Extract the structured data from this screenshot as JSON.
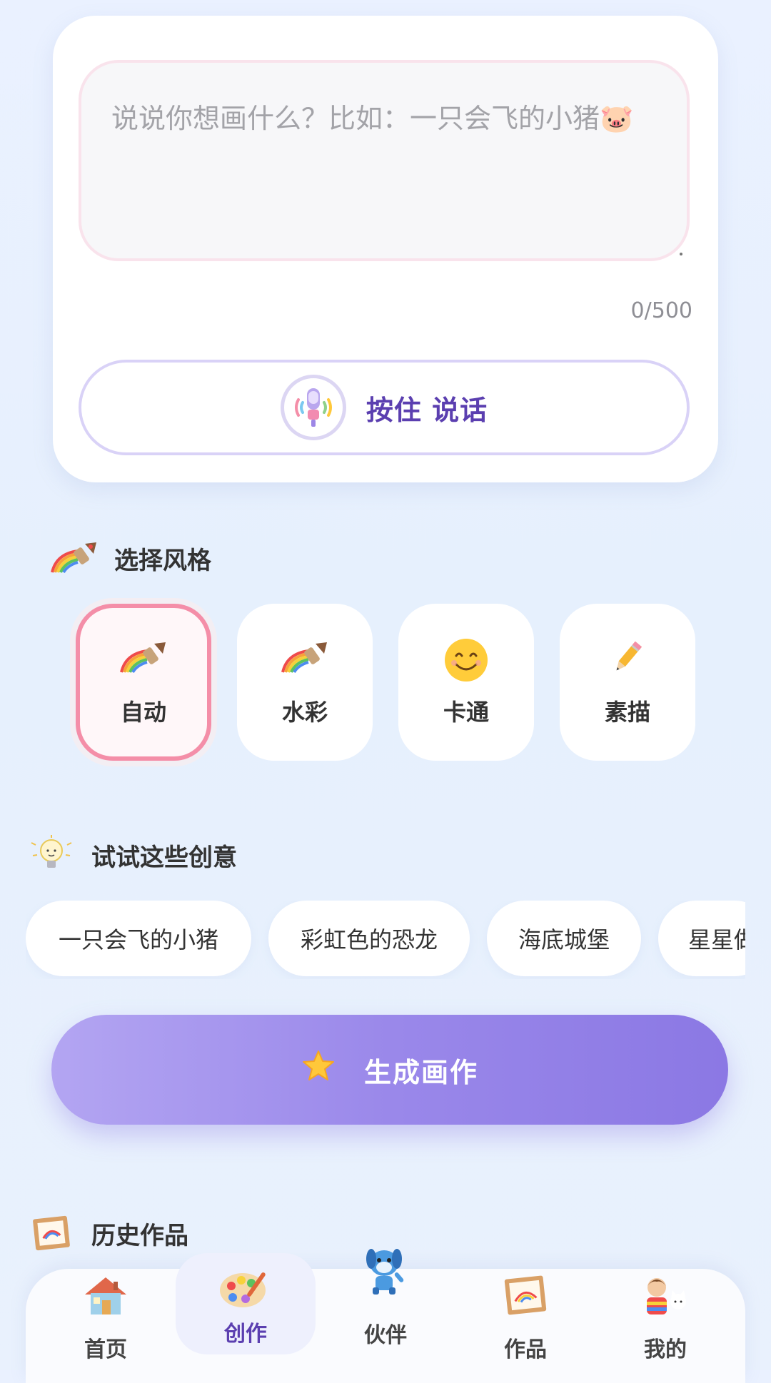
{
  "input": {
    "placeholder": "说说你想画什么？比如：一只会飞的小猪🐷",
    "counter": "0/500"
  },
  "voice": {
    "label": "按住 说话",
    "icon": "microphone-icon"
  },
  "styles": {
    "title": "选择风格",
    "title_icon": "rainbow-brush-icon",
    "items": [
      {
        "label": "自动",
        "icon": "rainbow-brush-icon",
        "selected": true
      },
      {
        "label": "水彩",
        "icon": "rainbow-brush-icon",
        "selected": false
      },
      {
        "label": "卡通",
        "icon": "smiley-icon",
        "selected": false
      },
      {
        "label": "素描",
        "icon": "pencil-icon",
        "selected": false
      }
    ]
  },
  "ideas": {
    "title": "试试这些创意",
    "title_icon": "lightbulb-icon",
    "chips": [
      "一只会飞的小猪",
      "彩虹色的恐龙",
      "海底城堡",
      "星星做"
    ]
  },
  "generate": {
    "label": "生成画作",
    "icon": "star-icon"
  },
  "history": {
    "title": "历史作品",
    "title_icon": "framed-picture-icon"
  },
  "tabbar": {
    "items": [
      {
        "label": "首页",
        "icon": "house-icon",
        "active": false
      },
      {
        "label": "创作",
        "icon": "palette-icon",
        "active": true
      },
      {
        "label": "伙伴",
        "icon": "robot-dog-icon",
        "active": false
      },
      {
        "label": "作品",
        "icon": "framed-picture-icon",
        "active": false
      },
      {
        "label": "我的",
        "icon": "kids-icon",
        "active": false
      }
    ]
  },
  "colors": {
    "accent": "#5b3fb0",
    "selected_border": "#f48ea8",
    "generate_gradient_start": "#b3a5f2",
    "generate_gradient_end": "#8b78e4"
  }
}
